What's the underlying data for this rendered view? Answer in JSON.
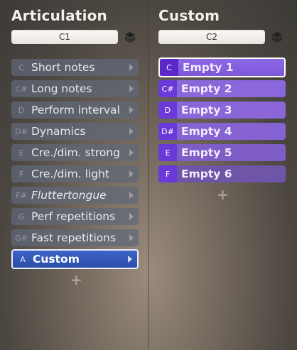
{
  "articulation": {
    "title": "Articulation",
    "key_value": "C1",
    "items": [
      {
        "key": "C",
        "label": "Short notes"
      },
      {
        "key": "C#",
        "label": "Long notes"
      },
      {
        "key": "D",
        "label": "Perform interval"
      },
      {
        "key": "D#",
        "label": "Dynamics"
      },
      {
        "key": "E",
        "label": "Cre./dim. strong"
      },
      {
        "key": "F",
        "label": "Cre./dim. light"
      },
      {
        "key": "F#",
        "label": "Fluttertongue"
      },
      {
        "key": "G",
        "label": "Perf repetitions"
      },
      {
        "key": "G#",
        "label": "Fast repetitions"
      },
      {
        "key": "A",
        "label": "Custom"
      }
    ],
    "selected_index": 9,
    "add_label": "+"
  },
  "custom": {
    "title": "Custom",
    "key_value": "C2",
    "items": [
      {
        "key": "C",
        "label": "Empty 1",
        "color": "#8a64e4"
      },
      {
        "key": "C#",
        "label": "Empty 2",
        "color": "#8b67dc"
      },
      {
        "key": "D",
        "label": "Empty 3",
        "color": "#8a66d8"
      },
      {
        "key": "D#",
        "label": "Empty 4",
        "color": "#8663d2"
      },
      {
        "key": "E",
        "label": "Empty 5",
        "color": "#7e5ec6"
      },
      {
        "key": "F",
        "label": "Empty 6",
        "color": "#6e55a8"
      }
    ],
    "selected_index": 0,
    "add_label": "+"
  },
  "icons": {
    "layers": "layers-icon",
    "arrow": "chevron-right-icon"
  }
}
